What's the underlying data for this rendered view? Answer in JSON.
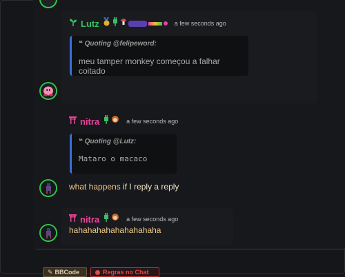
{
  "messages": [
    {
      "user": "Lutz",
      "user_color": "#3bbf63",
      "timestamp": "a few seconds ago",
      "quote": {
        "header": "Quoting @felipeword:",
        "body": "meu tamper monkey começou a falhar coitado"
      }
    },
    {
      "user": "nitra",
      "user_color": "#e8449a",
      "timestamp": "a few seconds ago",
      "quote": {
        "header": "Quoting @Lutz:",
        "body": "Mataro o macaco"
      },
      "body_parts": [
        "what happens",
        " if I reply a reply"
      ]
    },
    {
      "user": "nitra",
      "user_color": "#e8449a",
      "timestamp": "a few seconds ago",
      "body": "hahahahahahahahahaha"
    }
  ],
  "bottom_buttons": [
    {
      "label": "BBCode"
    },
    {
      "label": "Regras no Chat"
    }
  ],
  "colors": {
    "accent_green": "#2fc54a",
    "quote_bar": "#3b6fd8",
    "message_text": "#f1c988",
    "button_red": "#c4302b"
  }
}
